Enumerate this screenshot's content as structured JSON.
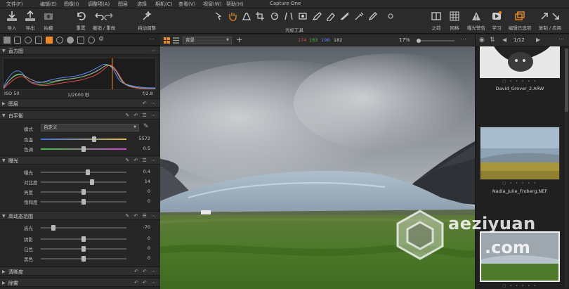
{
  "menu": [
    "文件(F)",
    "编辑(E)",
    "图像(I)",
    "调整项(A)",
    "图层",
    "选择",
    "相机(C)",
    "查看(V)",
    "视窗(W)",
    "帮助(H)"
  ],
  "app_title": "Capture One",
  "menu_more": "⋯",
  "toolbar": {
    "left_buttons": [
      {
        "label": "导入",
        "icon": "import-icon"
      },
      {
        "label": "导出",
        "icon": "export-icon"
      },
      {
        "label": "拍摄",
        "icon": "camera-icon"
      },
      {
        "label": "重置",
        "icon": "reset-icon"
      },
      {
        "label": "撤销 / 重做",
        "icon": "undo-redo-icon"
      },
      {
        "label": "自动调整",
        "icon": "auto-adjust-icon"
      }
    ],
    "cursor_tools_label": "光标工具",
    "right_buttons": [
      {
        "label": "之前",
        "icon": "before-icon"
      },
      {
        "label": "网格",
        "icon": "grid-icon"
      },
      {
        "label": "曝光警告",
        "icon": "exposure-warning-icon"
      },
      {
        "label": "学习",
        "icon": "learn-icon"
      },
      {
        "label": "编辑已选项",
        "icon": "edit-selected-icon"
      },
      {
        "label": "复制 / 应用",
        "icon": "copy-apply-icon"
      }
    ]
  },
  "left_panel": {
    "histogram": {
      "title": "直方图",
      "iso": "ISO 50",
      "shutter": "1/2000 秒",
      "aperture": "f/2.8"
    },
    "layers": {
      "title": "图层"
    },
    "white_balance": {
      "title": "白平衡",
      "mode_label": "模式",
      "mode_value": "自定义",
      "rows": [
        {
          "label": "色温",
          "value": "5572",
          "position": 0.62
        },
        {
          "label": "色调",
          "value": "0.5",
          "position": 0.5
        }
      ]
    },
    "exposure": {
      "title": "曝光",
      "rows": [
        {
          "label": "曝光",
          "value": "0.4",
          "position": 0.55
        },
        {
          "label": "对比度",
          "value": "14",
          "position": 0.6
        },
        {
          "label": "亮度",
          "value": "0",
          "position": 0.5
        },
        {
          "label": "饱和度",
          "value": "0",
          "position": 0.5
        }
      ]
    },
    "hdr": {
      "title": "高动态范围",
      "rows": [
        {
          "label": "高光",
          "value": "-70",
          "position": 0.15
        },
        {
          "label": "阴影",
          "value": "0",
          "position": 0.5
        },
        {
          "label": "白色",
          "value": "0",
          "position": 0.5
        },
        {
          "label": "黑色",
          "value": "0",
          "position": 0.5
        }
      ]
    },
    "clarity": {
      "title": "清晰度"
    },
    "dehaze": {
      "title": "除雾"
    }
  },
  "viewer": {
    "background_select": "背景",
    "rgb": {
      "r": "174",
      "g": "183",
      "b": "198",
      "l": "182"
    },
    "colors": {
      "r": "#e04848",
      "g": "#4cc04c",
      "b": "#5a8cf0",
      "l": "#c8c8c8"
    },
    "zoom": "17%"
  },
  "browser": {
    "counter": "1/12",
    "files": [
      "David_Grover_2.ARW",
      "Nadia_Julie_Froberg.NEF"
    ]
  },
  "watermark": {
    "line1": "aeziyuan",
    "line2": ".com"
  },
  "accent": "#f08a24"
}
